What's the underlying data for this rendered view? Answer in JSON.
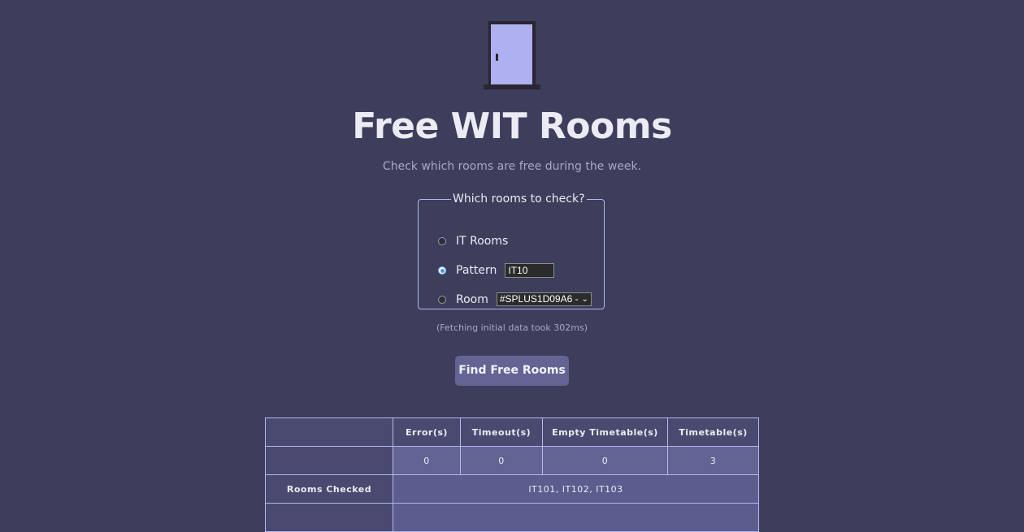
{
  "header": {
    "title": "Free WIT Rooms",
    "subtitle": "Check which rooms are free during the week."
  },
  "form": {
    "legend": "Which rooms to check?",
    "options": [
      {
        "label": "IT Rooms",
        "checked": false
      },
      {
        "label": "Pattern",
        "checked": true
      },
      {
        "label": "Room",
        "checked": false
      }
    ],
    "pattern_value": "IT10",
    "room_selected": "#SPLUS1D09A6 -"
  },
  "fetch_note": "(Fetching initial data took 302ms)",
  "find_button_label": "Find Free Rooms",
  "results": {
    "headers": [
      "",
      "Error(s)",
      "Timeout(s)",
      "Empty Timetable(s)",
      "Timetable(s)"
    ],
    "counts": [
      "0",
      "0",
      "0",
      "3"
    ],
    "rooms_checked_label": "Rooms Checked",
    "rooms_checked_value": "IT101, IT102, IT103"
  },
  "colors": {
    "background": "#3d3d5c",
    "accent": "#646494",
    "border": "#b5b7f0",
    "door": "#aeb0f0"
  }
}
